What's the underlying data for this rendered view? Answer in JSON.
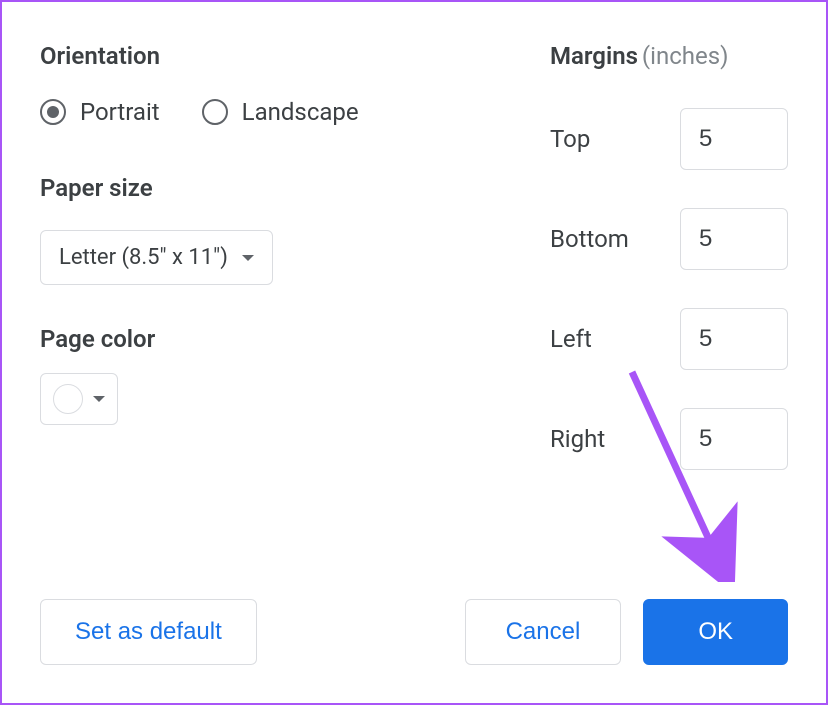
{
  "orientation": {
    "label": "Orientation",
    "options": [
      {
        "label": "Portrait",
        "selected": true
      },
      {
        "label": "Landscape",
        "selected": false
      }
    ]
  },
  "paperSize": {
    "label": "Paper size",
    "value": "Letter (8.5\" x 11\")"
  },
  "pageColor": {
    "label": "Page color",
    "value": "#ffffff"
  },
  "margins": {
    "label": "Margins",
    "unit": "(inches)",
    "fields": {
      "top": {
        "label": "Top",
        "value": "5"
      },
      "bottom": {
        "label": "Bottom",
        "value": "5"
      },
      "left": {
        "label": "Left",
        "value": "5"
      },
      "right": {
        "label": "Right",
        "value": "5"
      }
    }
  },
  "buttons": {
    "setDefault": "Set as default",
    "cancel": "Cancel",
    "ok": "OK"
  }
}
